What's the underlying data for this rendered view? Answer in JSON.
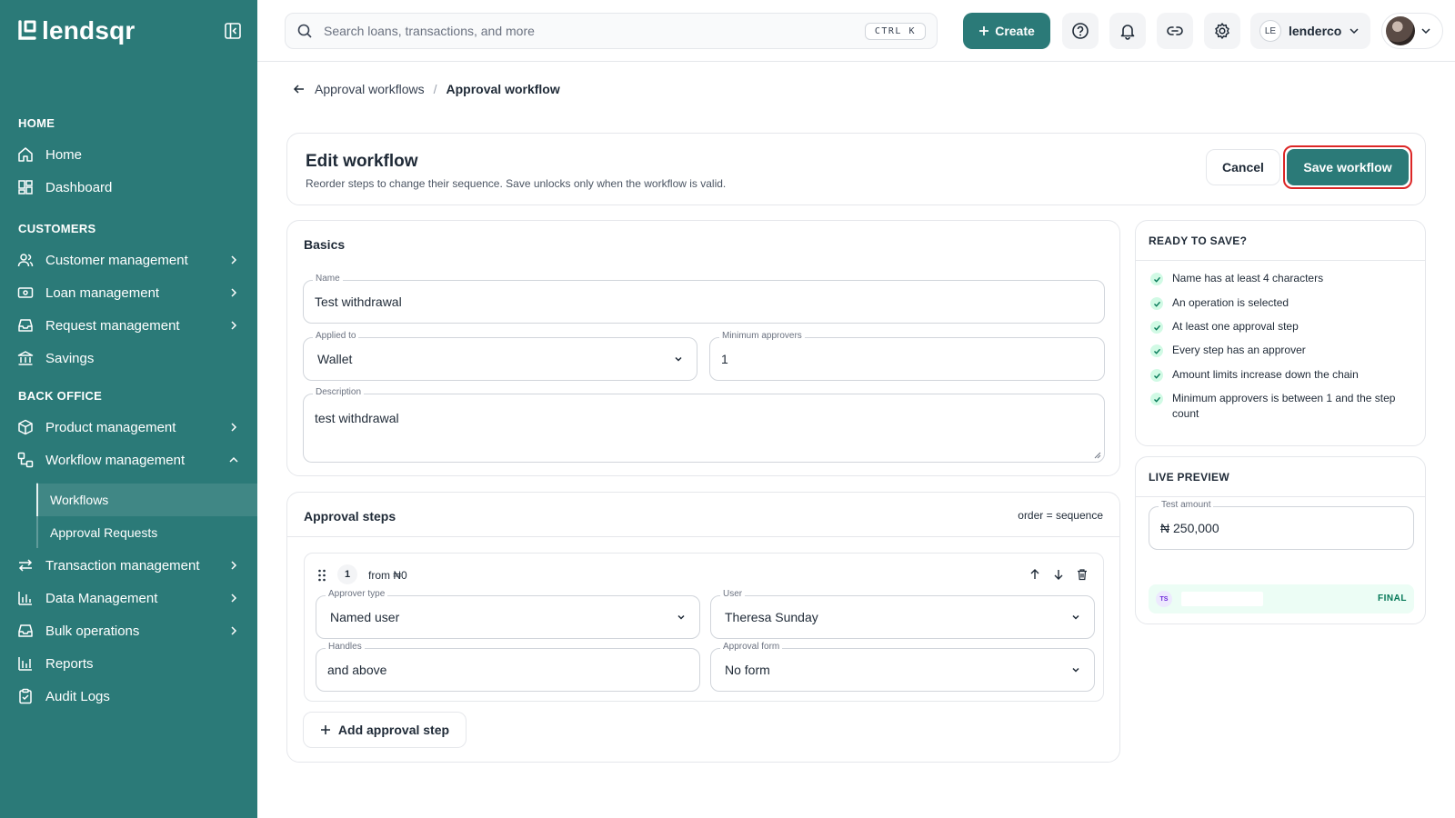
{
  "app": {
    "brand": "lendsqr"
  },
  "sidebar": {
    "sections": {
      "home": "HOME",
      "customers": "CUSTOMERS",
      "back_office": "BACK OFFICE"
    },
    "items": {
      "home": "Home",
      "dashboard": "Dashboard",
      "customer_management": "Customer management",
      "loan_management": "Loan management",
      "request_management": "Request management",
      "savings": "Savings",
      "product_management": "Product management",
      "workflow_management": "Workflow management",
      "workflows": "Workflows",
      "approval_requests": "Approval Requests",
      "transaction_management": "Transaction management",
      "data_management": "Data Management",
      "bulk_operations": "Bulk operations",
      "reports": "Reports",
      "audit_logs": "Audit Logs"
    },
    "active_item": "Workflows"
  },
  "topbar": {
    "search_placeholder": "Search loans, transactions, and more",
    "shortcut": "CTRL K",
    "create_label": "Create",
    "org_initials": "LE",
    "org_name": "lenderco"
  },
  "breadcrumb": {
    "parent": "Approval workflows",
    "separator": "/",
    "current": "Approval workflow"
  },
  "header": {
    "title": "Edit workflow",
    "subtitle": "Reorder steps to change their sequence. Save unlocks only when the workflow is valid.",
    "cancel_label": "Cancel",
    "save_label": "Save workflow"
  },
  "basics": {
    "title": "Basics",
    "name": {
      "label": "Name",
      "value": "Test withdrawal"
    },
    "applied_to": {
      "label": "Applied to",
      "value": "Wallet"
    },
    "min_approvers": {
      "label": "Minimum approvers",
      "value": "1"
    },
    "description": {
      "label": "Description",
      "value": "test withdrawal"
    }
  },
  "steps": {
    "title": "Approval steps",
    "order_note": "order = sequence",
    "items": [
      {
        "number": "1",
        "from": "from ₦0",
        "approver_type": {
          "label": "Approver type",
          "value": "Named user"
        },
        "user": {
          "label": "User",
          "value": "Theresa Sunday"
        },
        "handles": {
          "label": "Handles",
          "value": "and above"
        },
        "approval_form": {
          "label": "Approval form",
          "value": "No form"
        }
      }
    ],
    "add_label": "Add approval step"
  },
  "ready": {
    "title": "READY TO SAVE?",
    "checks": [
      "Name has at least 4 characters",
      "An operation is selected",
      "At least one approval step",
      "Every step has an approver",
      "Amount limits increase down the chain",
      "Minimum approvers is between 1 and the step count"
    ]
  },
  "preview": {
    "title": "LIVE PREVIEW",
    "amount_label": "Test amount",
    "amount_value": "₦ 250,000",
    "row_initials": "TS",
    "row_tag": "FINAL"
  },
  "colors": {
    "brand": "#2b7a78",
    "highlight": "#dc2626",
    "success": "#047857"
  }
}
